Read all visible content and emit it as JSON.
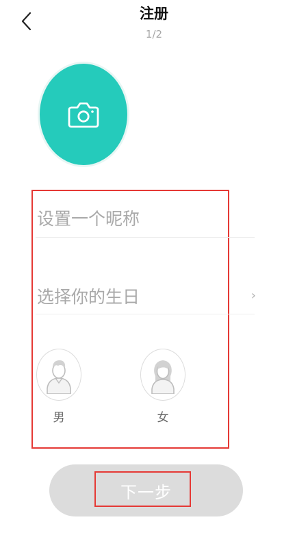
{
  "header": {
    "title": "注册",
    "step": "1/2",
    "back_icon": "chevron-left-icon"
  },
  "avatar": {
    "icon": "camera-icon",
    "background_color": "#25cbbb"
  },
  "form": {
    "nickname_placeholder": "设置一个昵称",
    "birthday_label": "选择你的生日",
    "birthday_chevron": "›"
  },
  "gender": {
    "male_label": "男",
    "female_label": "女",
    "male_icon": "male-avatar-icon",
    "female_icon": "female-avatar-icon"
  },
  "actions": {
    "next_label": "下一步"
  },
  "annotations": {
    "highlight_color": "#e53935"
  }
}
